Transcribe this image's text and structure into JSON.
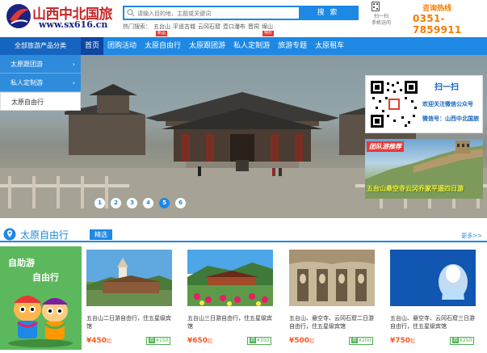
{
  "brand": {
    "name": "山西中北国旅",
    "url": "www.sx616.cn"
  },
  "search": {
    "placeholder": "请输入目的地，主题或关键词",
    "button": "搜 索"
  },
  "hot_search": {
    "label": "热门搜索：",
    "items": [
      "五台山",
      "平遥古城",
      "云冈石窟",
      "壶口瀑布",
      "晋祠",
      "绵山"
    ]
  },
  "badges": {
    "new": "新品",
    "special": "特价"
  },
  "scan_text": "扫一扫\n手机访问",
  "hotline": {
    "label": "咨询热线",
    "number": "0351-7859911"
  },
  "nav": {
    "category": "全部旅游产品分类",
    "items": [
      "首页",
      "团购活动",
      "太原自由行",
      "太原跟团游",
      "私人定制游",
      "旅游专题",
      "太原租车"
    ]
  },
  "sidebar": {
    "items": [
      {
        "label": "太原跟团游",
        "arrow": "›"
      },
      {
        "label": "私人定制游",
        "arrow": "›"
      },
      {
        "label": "太原自由行",
        "arrow": ""
      }
    ]
  },
  "slider": {
    "dots": [
      "1",
      "2",
      "3",
      "4",
      "5",
      "6"
    ],
    "active_index": 4
  },
  "promo_box": {
    "scan": "扫一扫",
    "line1": "欢迎关注微信公众号",
    "line2": "微信号：山西中北国旅"
  },
  "group_tour": {
    "tag": "团队游推荐",
    "caption": "五台山悬空寺云冈乔家平遥四日游"
  },
  "section": {
    "title": "太原自由行",
    "tag": "精选",
    "more": "更多>>"
  },
  "promo_card": {
    "title": "自助游",
    "subtitle": "自由行"
  },
  "cards": [
    {
      "desc": "五台山二日游自由行，住五星级宾馆",
      "price": "¥450",
      "unit": "起",
      "voucher_mark": "券",
      "voucher": "¥150"
    },
    {
      "desc": "五台山三日游自由行，住五星级宾馆",
      "price": "¥650",
      "unit": "起",
      "voucher_mark": "券",
      "voucher": "¥350"
    },
    {
      "desc": "五台山、悬空寺、云冈石窟二日游自由行，住五星级宾馆",
      "price": "¥500",
      "unit": "起",
      "voucher_mark": "券",
      "voucher": "¥200"
    },
    {
      "desc": "五台山、悬空寺、云冈石窟三日游自由行，住五星级宾馆",
      "price": "¥750",
      "unit": "起",
      "voucher_mark": "券",
      "voucher": "¥250"
    }
  ],
  "colors": {
    "primary": "#1e88e5",
    "brand_red": "#c62828",
    "orange": "#f57c00",
    "green": "#5cb85c"
  }
}
